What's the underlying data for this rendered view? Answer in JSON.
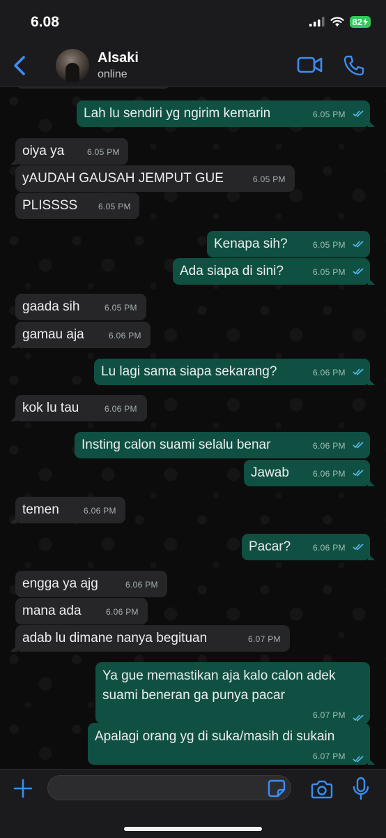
{
  "status_bar": {
    "time": "6.08",
    "battery": "82"
  },
  "header": {
    "name": "Alsaki",
    "status": "online"
  },
  "messages": [
    {
      "dir": "out",
      "text": "Lah lu sendiri yg ngirim kemarin",
      "time": "6.05 PM"
    },
    {
      "dir": "in",
      "text": "oiya ya",
      "time": "6.05 PM"
    },
    {
      "dir": "in",
      "text": "yAUDAH GAUSAH JEMPUT GUE",
      "time": "6.05 PM"
    },
    {
      "dir": "in",
      "text": "PLISSSS",
      "time": "6.05 PM"
    },
    {
      "dir": "out",
      "text": "Kenapa sih?",
      "time": "6.05 PM"
    },
    {
      "dir": "out",
      "text": "Ada siapa di sini?",
      "time": "6.05 PM"
    },
    {
      "dir": "in",
      "text": "gaada sih",
      "time": "6.05 PM"
    },
    {
      "dir": "in",
      "text": "gamau aja",
      "time": "6.06 PM"
    },
    {
      "dir": "out",
      "text": "Lu lagi sama siapa sekarang?",
      "time": "6.06 PM"
    },
    {
      "dir": "in",
      "text": "kok lu tau",
      "time": "6.06 PM"
    },
    {
      "dir": "out",
      "text": "Insting calon suami selalu benar",
      "time": "6.06 PM"
    },
    {
      "dir": "out",
      "text": "Jawab",
      "time": "6.06 PM"
    },
    {
      "dir": "in",
      "text": "temen",
      "time": "6.06 PM"
    },
    {
      "dir": "out",
      "text": "Pacar?",
      "time": "6.06 PM"
    },
    {
      "dir": "in",
      "text": "engga ya ajg",
      "time": "6.06 PM"
    },
    {
      "dir": "in",
      "text": "mana ada",
      "time": "6.06 PM"
    },
    {
      "dir": "in",
      "text": "adab lu dimane nanya begituan",
      "time": "6.07 PM"
    },
    {
      "dir": "out",
      "lines": [
        "Ya gue memastikan aja kalo calon adek",
        "suami beneran ga punya pacar"
      ],
      "time": "6.07 PM"
    },
    {
      "dir": "out",
      "text": "Apalagi orang yg di suka/masih di sukain",
      "time": "6.07 PM"
    }
  ],
  "colors": {
    "accent": "#3b8ef3",
    "outgoing_bubble": "#0f5043",
    "incoming_bubble": "#262628",
    "read_tick": "#53bdeb"
  },
  "icons": [
    "back-chevron-icon",
    "video-call-icon",
    "phone-icon",
    "plus-icon",
    "sticker-icon",
    "camera-icon",
    "microphone-icon"
  ]
}
